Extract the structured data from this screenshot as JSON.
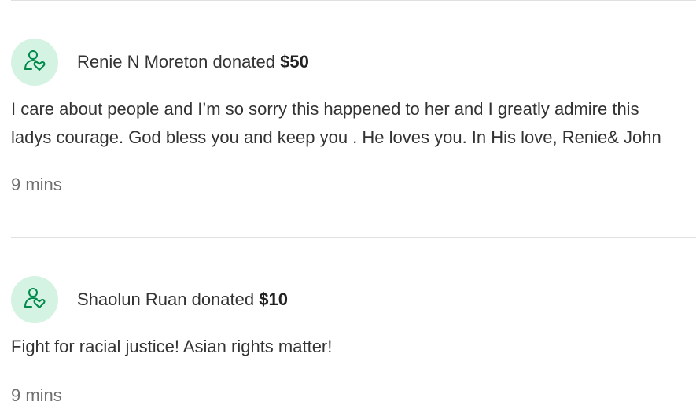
{
  "donations": [
    {
      "donor": "Renie N Moreton",
      "action": "donated",
      "amount": "$50",
      "message": "I care about people and I’m so sorry this happened to her and I greatly admire this ladys courage. God bless you and keep you . He loves you. In His love, Renie& John",
      "time": "9 mins",
      "icon": "donor-heart-icon"
    },
    {
      "donor": "Shaolun Ruan",
      "action": "donated",
      "amount": "$10",
      "message": "Fight for racial justice! Asian rights matter!",
      "time": "9 mins",
      "icon": "donor-heart-icon"
    }
  ],
  "colors": {
    "icon_green": "#008a4b",
    "avatar_bg": "#d5f3e3",
    "divider": "#e0e0e0"
  }
}
